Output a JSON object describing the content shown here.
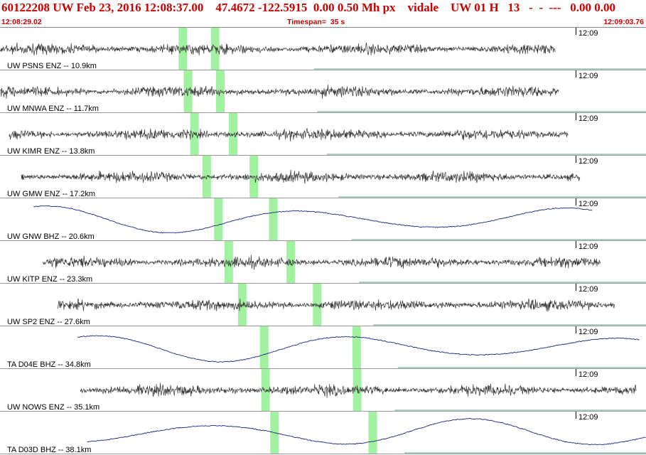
{
  "header": {
    "event_line": "60122208 UW Feb 23, 2016 12:08:37.00    47.4672 -122.5915  0.00 0.50 Mh px    vidale    UW 01 H   13   -  -  ---   0.00 0.00",
    "start_time": "12:08:29.02",
    "timespan": "Timespan=  35 s",
    "end_time": "12:09:03.76"
  },
  "colors": {
    "header_text": "#cc0000",
    "trace_short_period": "#333333",
    "trace_broadband": "#1a237e",
    "pick_highlight": "#90ee90",
    "baseline": "#5e9c8e",
    "panel_border": "#9a9a9a"
  },
  "time_marker": "12:09",
  "channels": [
    {
      "label": "UW PSNS ENZ -- 10.9km",
      "kind": "sp",
      "trace": [
        0.0,
        0.86
      ],
      "picks": [
        0.283,
        0.333
      ]
    },
    {
      "label": "UW MNWA ENZ -- 11.7km",
      "kind": "sp",
      "trace": [
        0.0,
        0.865
      ],
      "picks": [
        0.291,
        0.341
      ]
    },
    {
      "label": "UW KIMR ENZ -- 13.8km",
      "kind": "sp",
      "trace": [
        0.014,
        0.88
      ],
      "picks": [
        0.301,
        0.361
      ]
    },
    {
      "label": "UW GMW ENZ -- 17.2km",
      "kind": "sp",
      "trace": [
        0.033,
        0.898
      ],
      "picks": [
        0.32,
        0.393
      ]
    },
    {
      "label": "UW GNW BHZ -- 20.6km",
      "kind": "bb",
      "trace": [
        0.052,
        0.918
      ],
      "picks": [
        0.338,
        0.423
      ]
    },
    {
      "label": "UW KITP ENZ -- 23.3km",
      "kind": "sp",
      "trace": [
        0.066,
        0.93
      ],
      "picks": [
        0.354,
        0.45
      ]
    },
    {
      "label": "UW SP2 ENZ -- 27.6km",
      "kind": "sp",
      "trace": [
        0.089,
        0.952
      ],
      "picks": [
        0.375,
        0.491
      ]
    },
    {
      "label": "TA D04E BHZ -- 34.8km",
      "kind": "bb",
      "trace": [
        0.12,
        0.99
      ],
      "picks": [
        0.409,
        0.552
      ]
    },
    {
      "label": "UW NOWS ENZ -- 35.1km",
      "kind": "sp",
      "trace": [
        0.124,
        0.985
      ],
      "picks": [
        0.411,
        0.553
      ]
    },
    {
      "label": "TA D03D BHZ -- 38.1km",
      "kind": "bb",
      "trace": [
        0.135,
        1.0
      ],
      "picks": [
        0.425,
        0.577
      ]
    }
  ]
}
